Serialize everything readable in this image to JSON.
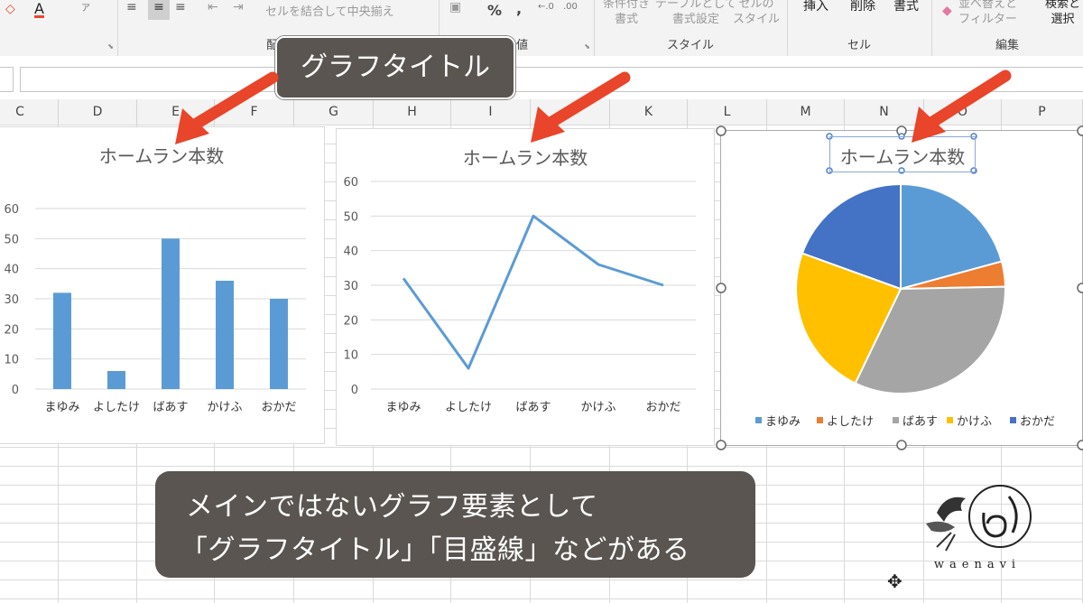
{
  "ribbon": {
    "font_color_label": "A",
    "merge_center_label": "セルを結合して中央揃え",
    "percent_label": "%",
    "comma_label": ",",
    "cond_format_label": "条件付き\n書式",
    "table_format_label": "テーブルとして\n書式設定",
    "cell_style_label": "セルの\nスタイル",
    "insert_label": "挿入",
    "delete_label": "削除",
    "format_label": "書式",
    "sort_filter_label": "並べ替えと\nフィルター",
    "find_select_label": "検索と\n選択",
    "groups": {
      "alignment": "配置",
      "number": "数値",
      "style": "スタイル",
      "cells": "セル",
      "editing": "編集"
    }
  },
  "columns": [
    "C",
    "D",
    "E",
    "F",
    "G",
    "H",
    "I",
    "J",
    "K",
    "L",
    "M",
    "N",
    "O",
    "P"
  ],
  "callouts": {
    "top": "グラフタイトル",
    "bottom_line1": "メインではないグラフ要素として",
    "bottom_line2": "「グラフタイトル」「目盛線」などがある"
  },
  "logo": {
    "text": "waenavi"
  },
  "colors": {
    "bar": "#5B9BD5",
    "orange": "#ED7D31",
    "gray": "#A5A5A5",
    "gold": "#FFC000",
    "darkblue": "#4472C4",
    "arrow": "#E8452A",
    "callout_bg": "#5a5550"
  },
  "chart_data": [
    {
      "type": "bar",
      "title": "ホームラン本数",
      "categories": [
        "まゆみ",
        "よしたけ",
        "ばあす",
        "かけふ",
        "おかだ"
      ],
      "values": [
        32,
        6,
        50,
        36,
        30
      ],
      "ylim": [
        0,
        60
      ],
      "yticks": [
        0,
        10,
        20,
        30,
        40,
        50,
        60
      ],
      "grid": true,
      "legend": "none"
    },
    {
      "type": "line",
      "title": "ホームラン本数",
      "categories": [
        "まゆみ",
        "よしたけ",
        "ばあす",
        "かけふ",
        "おかだ"
      ],
      "values": [
        32,
        6,
        50,
        36,
        30
      ],
      "ylim": [
        0,
        60
      ],
      "yticks": [
        0,
        10,
        20,
        30,
        40,
        50,
        60
      ],
      "grid": true,
      "legend": "none"
    },
    {
      "type": "pie",
      "title": "ホームラン本数",
      "categories": [
        "まゆみ",
        "よしたけ",
        "ばあす",
        "かけふ",
        "おかだ"
      ],
      "values": [
        32,
        6,
        50,
        36,
        30
      ],
      "colors": [
        "#5B9BD5",
        "#ED7D31",
        "#A5A5A5",
        "#FFC000",
        "#4472C4"
      ],
      "legend": "bottom"
    }
  ]
}
